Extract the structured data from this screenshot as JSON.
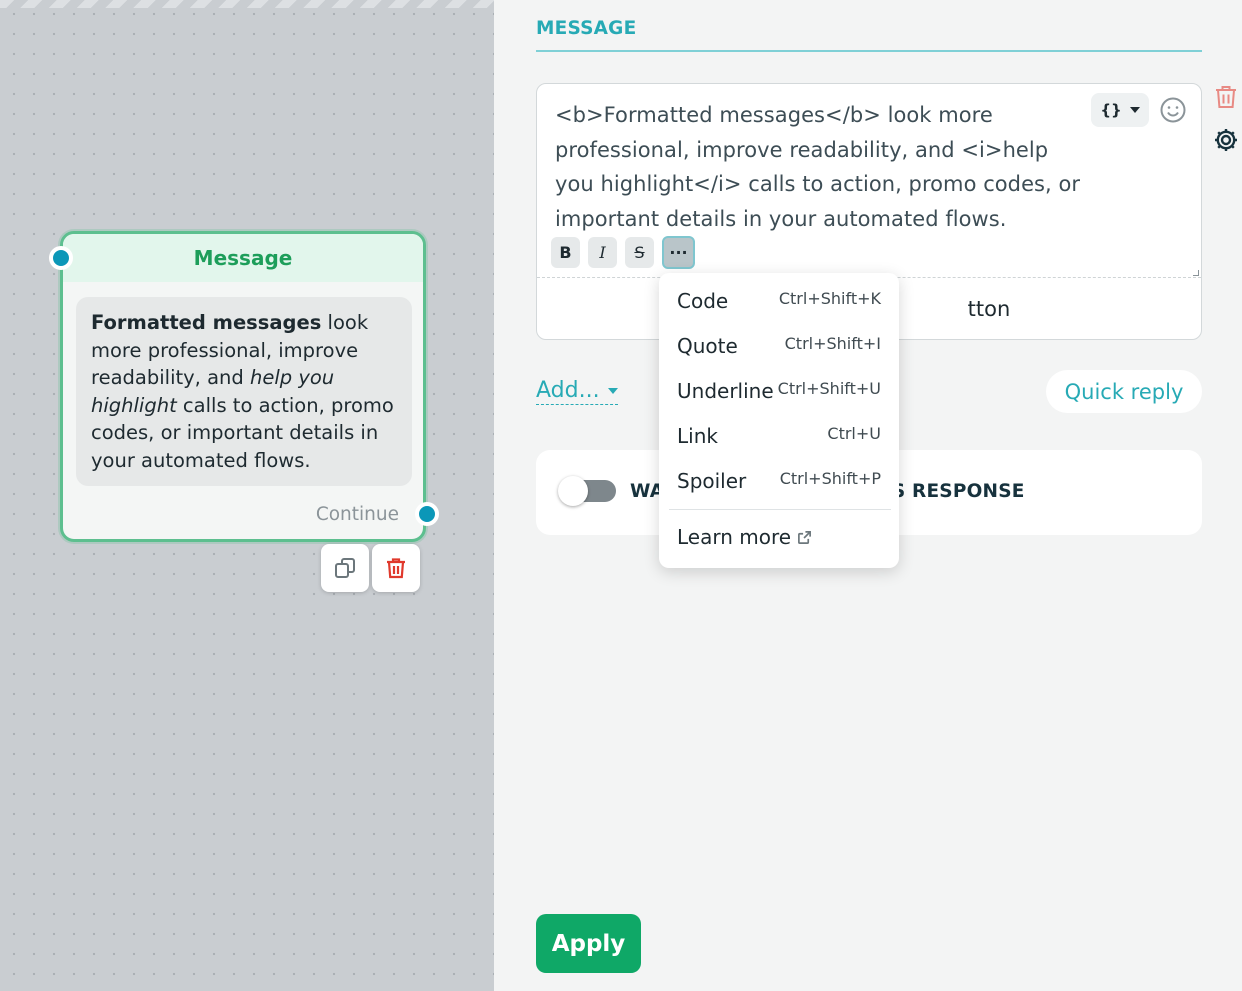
{
  "canvas": {
    "node": {
      "title": "Message",
      "bubble": {
        "bold_part": "Formatted messages",
        "part1": " look more professional, improve readability, and ",
        "italic_part": "help you highlight",
        "part2": " calls to action, promo codes, or important details in your automated flows."
      },
      "continue_label": "Continue",
      "actions": {
        "duplicate_icon": "copy-icon",
        "delete_icon": "trash-icon"
      }
    }
  },
  "panel": {
    "section_title": "MESSAGE",
    "editor": {
      "text": "<b>Formatted messages</b> look more professional, improve readability, and <i>help you highlight</i> calls to action, promo codes, or important details in your automated flows.",
      "variables_button": "{}",
      "format_buttons": {
        "bold": "B",
        "italic": "I",
        "strike": "S",
        "more": "···"
      },
      "add_button_partial": "tton"
    },
    "add_label": "Add...",
    "quick_reply_label": "Quick reply",
    "wait_label_left": "WA",
    "wait_label_right": "'S RESPONSE",
    "apply_label": "Apply"
  },
  "menu": {
    "items": [
      {
        "label": "Code",
        "shortcut": "Ctrl+Shift+K"
      },
      {
        "label": "Quote",
        "shortcut": "Ctrl+Shift+I"
      },
      {
        "label": "Underline",
        "shortcut": "Ctrl+Shift+U"
      },
      {
        "label": "Link",
        "shortcut": "Ctrl+U"
      },
      {
        "label": "Spoiler",
        "shortcut": "Ctrl+Shift+P"
      }
    ],
    "learn_more": "Learn more"
  },
  "colors": {
    "accent_teal": "#27aab5",
    "node_green": "#1d9e5a",
    "apply_green": "#0fa867",
    "delete_red": "#e0392c",
    "port_blue": "#0b97b8"
  }
}
